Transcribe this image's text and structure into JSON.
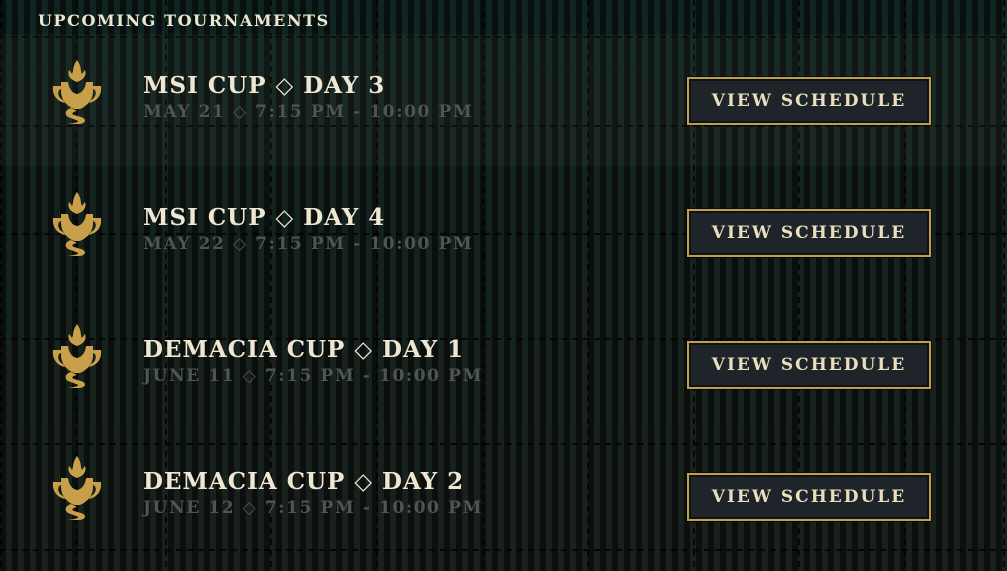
{
  "section": {
    "heading": "UPCOMING TOURNAMENTS"
  },
  "colors": {
    "accent_gold": "#c9a04a",
    "button_bg": "#1f242b",
    "title_text": "#efe7d2",
    "subtitle_text": "#4f5651"
  },
  "tournaments": [
    {
      "icon": "trophy-icon",
      "title": "MSI CUP ◇ DAY 3",
      "schedule": "MAY 21 ◇ 7:15 PM - 10:00 PM",
      "button_label": "VIEW SCHEDULE"
    },
    {
      "icon": "trophy-icon",
      "title": "MSI CUP ◇ DAY 4",
      "schedule": "MAY 22 ◇ 7:15 PM - 10:00 PM",
      "button_label": "VIEW SCHEDULE"
    },
    {
      "icon": "trophy-icon",
      "title": "DEMACIA CUP ◇ DAY 1",
      "schedule": "JUNE 11 ◇ 7:15 PM - 10:00 PM",
      "button_label": "VIEW SCHEDULE"
    },
    {
      "icon": "trophy-icon",
      "title": "DEMACIA CUP ◇ DAY 2",
      "schedule": "JUNE 12 ◇ 7:15 PM - 10:00 PM",
      "button_label": "VIEW SCHEDULE"
    }
  ]
}
